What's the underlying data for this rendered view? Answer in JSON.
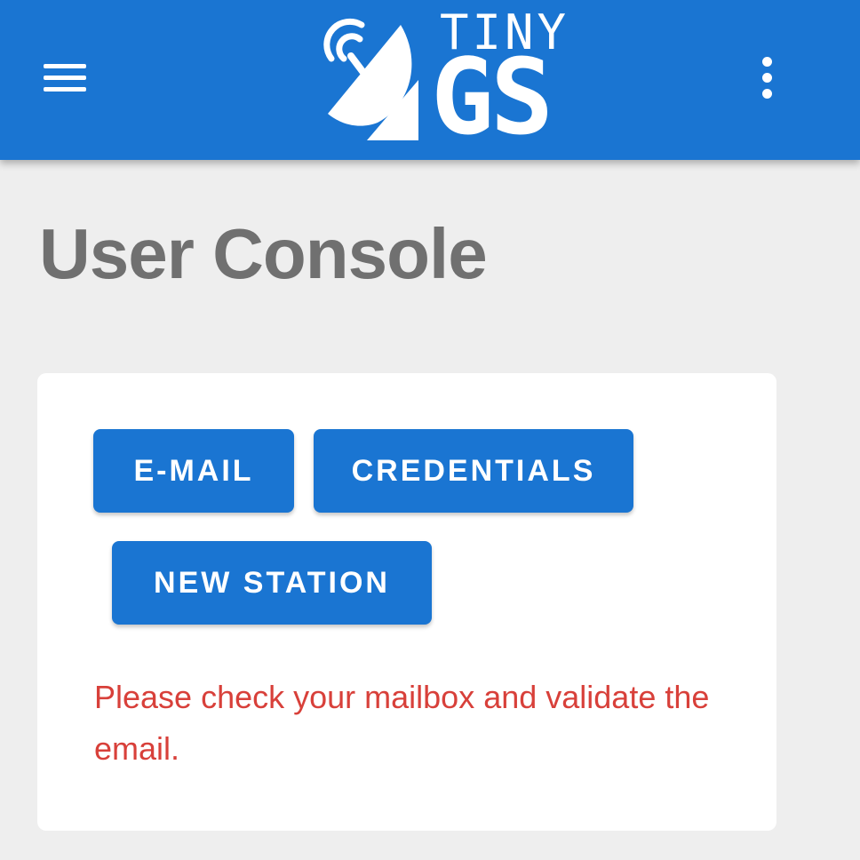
{
  "app_bar": {
    "background_color": "#1a75d2",
    "menu_icon": "hamburger-menu-icon",
    "more_icon": "more-vertical-icon",
    "logo": {
      "icon": "satellite-dish-icon",
      "line1": "TINY",
      "line2": "GS"
    }
  },
  "page": {
    "title": "User Console",
    "title_color": "#707070",
    "background_color": "#eeeeee"
  },
  "card": {
    "buttons": [
      {
        "label": "E-MAIL"
      },
      {
        "label": "CREDENTIALS"
      },
      {
        "label": "NEW STATION"
      }
    ],
    "button_color": "#1a75d2",
    "notice": {
      "text": "Please check your mailbox and validate the email.",
      "color": "#d8403a"
    }
  }
}
